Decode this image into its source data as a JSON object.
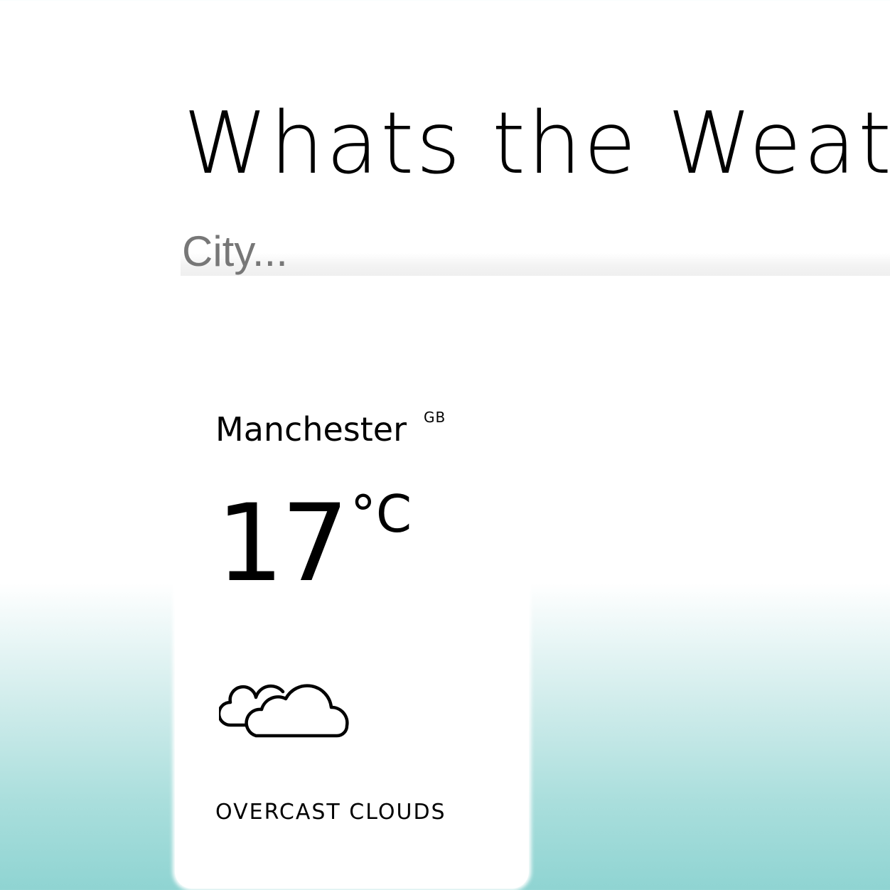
{
  "header": {
    "title": "Whats the Weat"
  },
  "search": {
    "placeholder": "City...",
    "value": ""
  },
  "weather": {
    "city": "Manchester",
    "country": "GB",
    "temperature": "17",
    "unit": "°C",
    "description": "OVERCAST CLOUDS",
    "icon": "overcast-clouds-icon"
  },
  "colors": {
    "background_gradient_top": "#ffffff",
    "background_gradient_bottom": "#8fd4d2",
    "card": "#ffffff",
    "text": "#000000",
    "placeholder": "#777777"
  }
}
